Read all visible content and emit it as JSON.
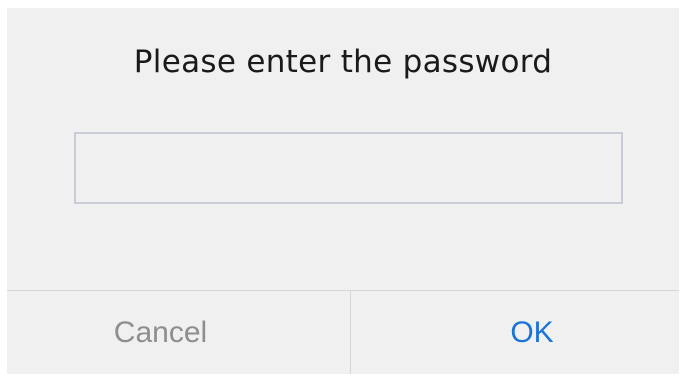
{
  "dialog": {
    "title": "Please enter the password",
    "password_value": "",
    "password_placeholder": "",
    "cancel_label": "Cancel",
    "ok_label": "OK"
  },
  "colors": {
    "dialog_background": "#f0f0f0",
    "title_text": "#1a1a1a",
    "input_border": "#c8ccd4",
    "divider": "#d6d6d6",
    "cancel_text": "#8e8e8e",
    "ok_text": "#1a73d9"
  }
}
